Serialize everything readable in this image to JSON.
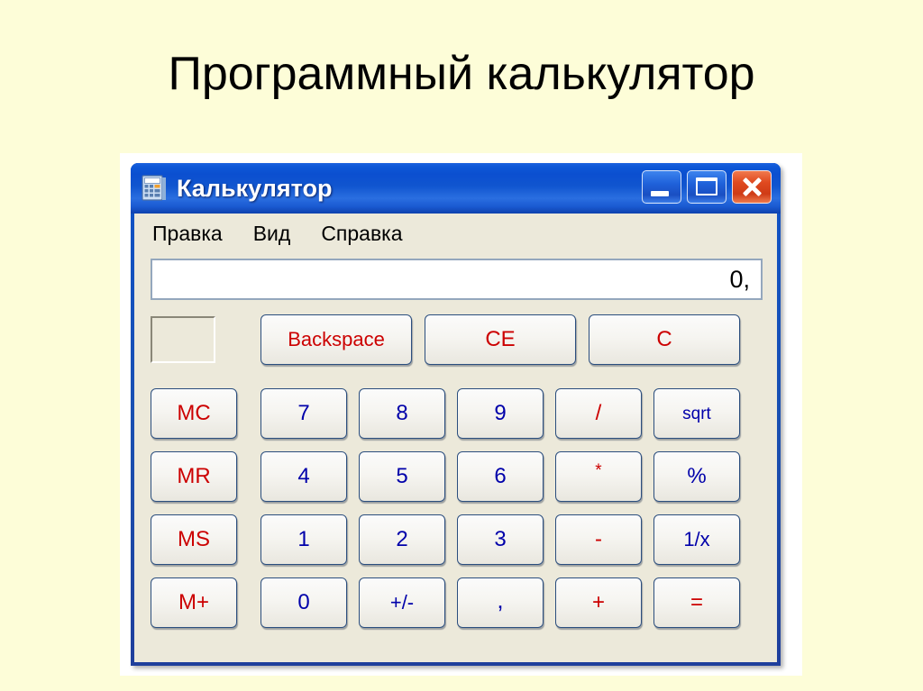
{
  "slide": {
    "title": "Программный калькулятор",
    "background_color": "#fdfdd8"
  },
  "window": {
    "title": "Калькулятор",
    "icon": "calculator-icon",
    "chrome_color": "#1a4fb0",
    "client_color": "#ece9da",
    "caption_buttons": {
      "minimize": "Свернуть",
      "maximize": "Развернуть",
      "close": "Закрыть"
    }
  },
  "menu": {
    "items": [
      {
        "label": "Правка"
      },
      {
        "label": "Вид"
      },
      {
        "label": "Справка"
      }
    ]
  },
  "display": {
    "value": "0,",
    "memory_indicator": ""
  },
  "keypad": {
    "colors": {
      "digit": "#0000aa",
      "operator": "#cc0000",
      "function": "#0000aa",
      "memory": "#cc0000"
    },
    "function_row": [
      {
        "label": "Backspace",
        "kind": "operator"
      },
      {
        "label": "CE",
        "kind": "operator"
      },
      {
        "label": "C",
        "kind": "operator"
      }
    ],
    "rows": [
      [
        {
          "label": "MC",
          "kind": "memory"
        },
        {
          "label": "7",
          "kind": "digit"
        },
        {
          "label": "8",
          "kind": "digit"
        },
        {
          "label": "9",
          "kind": "digit"
        },
        {
          "label": "/",
          "kind": "operator"
        },
        {
          "label": "sqrt",
          "kind": "function"
        }
      ],
      [
        {
          "label": "MR",
          "kind": "memory"
        },
        {
          "label": "4",
          "kind": "digit"
        },
        {
          "label": "5",
          "kind": "digit"
        },
        {
          "label": "6",
          "kind": "digit"
        },
        {
          "label": "*",
          "kind": "operator"
        },
        {
          "label": "%",
          "kind": "function"
        }
      ],
      [
        {
          "label": "MS",
          "kind": "memory"
        },
        {
          "label": "1",
          "kind": "digit"
        },
        {
          "label": "2",
          "kind": "digit"
        },
        {
          "label": "3",
          "kind": "digit"
        },
        {
          "label": "-",
          "kind": "operator"
        },
        {
          "label": "1/x",
          "kind": "function"
        }
      ],
      [
        {
          "label": "M+",
          "kind": "memory"
        },
        {
          "label": "0",
          "kind": "digit"
        },
        {
          "label": "+/-",
          "kind": "digit"
        },
        {
          "label": ",",
          "kind": "digit"
        },
        {
          "label": "+",
          "kind": "operator"
        },
        {
          "label": "=",
          "kind": "operator"
        }
      ]
    ]
  }
}
